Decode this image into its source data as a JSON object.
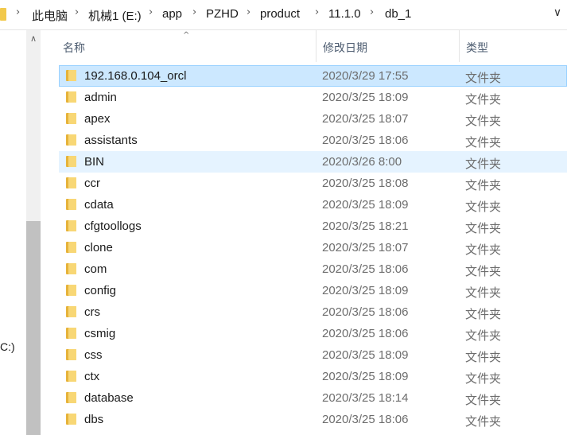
{
  "address_bar": {
    "crumbs": [
      "此电脑",
      "机械1 (E:)",
      "app",
      "PZHD",
      "product",
      "11.1.0",
      "db_1"
    ],
    "separator": "›",
    "dropdown_glyph": "∨"
  },
  "nav_pane": {
    "drive_label": "C:)",
    "scroll_up_glyph": "∧"
  },
  "columns": {
    "name": "名称",
    "date": "修改日期",
    "type": "类型",
    "sort_glyph": "^"
  },
  "files": [
    {
      "name": "192.168.0.104_orcl",
      "date": "2020/3/29 17:55",
      "type": "文件夹",
      "state": "selected"
    },
    {
      "name": "admin",
      "date": "2020/3/25 18:09",
      "type": "文件夹",
      "state": ""
    },
    {
      "name": "apex",
      "date": "2020/3/25 18:07",
      "type": "文件夹",
      "state": ""
    },
    {
      "name": "assistants",
      "date": "2020/3/25 18:06",
      "type": "文件夹",
      "state": ""
    },
    {
      "name": "BIN",
      "date": "2020/3/26 8:00",
      "type": "文件夹",
      "state": "hover"
    },
    {
      "name": "ccr",
      "date": "2020/3/25 18:08",
      "type": "文件夹",
      "state": ""
    },
    {
      "name": "cdata",
      "date": "2020/3/25 18:09",
      "type": "文件夹",
      "state": ""
    },
    {
      "name": "cfgtoollogs",
      "date": "2020/3/25 18:21",
      "type": "文件夹",
      "state": ""
    },
    {
      "name": "clone",
      "date": "2020/3/25 18:07",
      "type": "文件夹",
      "state": ""
    },
    {
      "name": "com",
      "date": "2020/3/25 18:06",
      "type": "文件夹",
      "state": ""
    },
    {
      "name": "config",
      "date": "2020/3/25 18:09",
      "type": "文件夹",
      "state": ""
    },
    {
      "name": "crs",
      "date": "2020/3/25 18:06",
      "type": "文件夹",
      "state": ""
    },
    {
      "name": "csmig",
      "date": "2020/3/25 18:06",
      "type": "文件夹",
      "state": ""
    },
    {
      "name": "css",
      "date": "2020/3/25 18:09",
      "type": "文件夹",
      "state": ""
    },
    {
      "name": "ctx",
      "date": "2020/3/25 18:09",
      "type": "文件夹",
      "state": ""
    },
    {
      "name": "database",
      "date": "2020/3/25 18:14",
      "type": "文件夹",
      "state": ""
    },
    {
      "name": "dbs",
      "date": "2020/3/25 18:06",
      "type": "文件夹",
      "state": ""
    }
  ],
  "colors": {
    "selected_bg": "#cce8ff",
    "hover_bg": "#e5f3ff",
    "folder": "#f8d775"
  },
  "icons": {
    "folder": "folder-icon",
    "chevron": "chevron-right-icon",
    "dropdown": "chevron-down-icon"
  }
}
